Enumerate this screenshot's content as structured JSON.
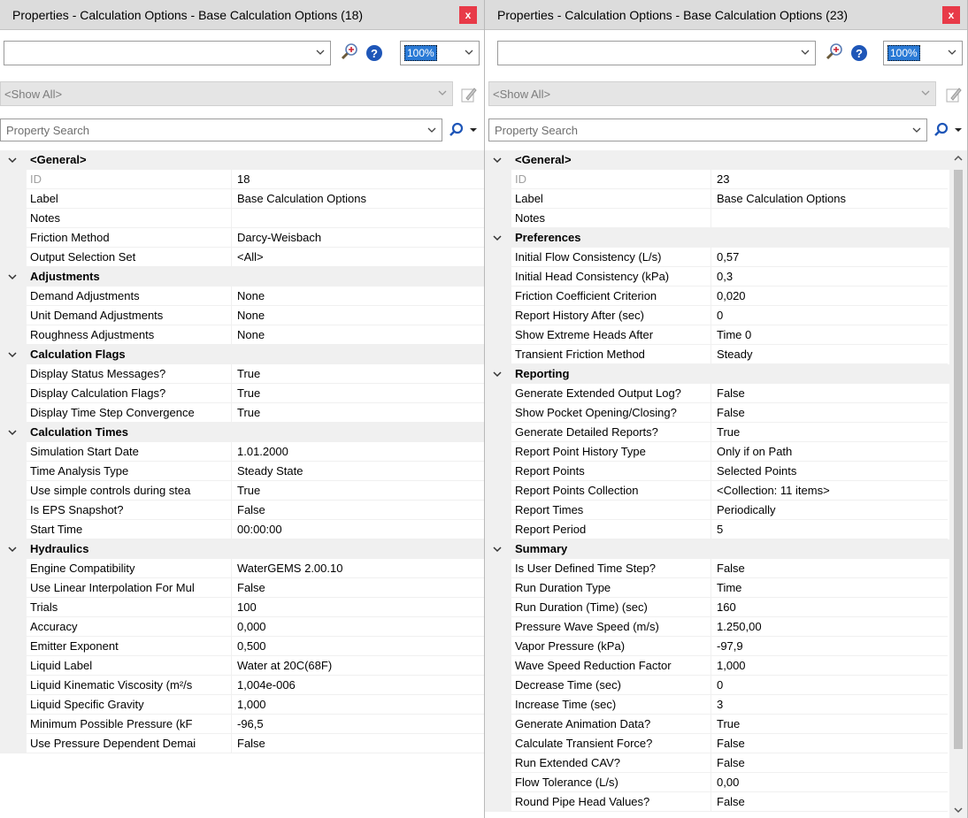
{
  "colors": {
    "close": "#e83a48",
    "selection": "#2a7ad6",
    "category_bg": "#f0f0f0"
  },
  "left": {
    "title": "Properties - Calculation Options - Base Calculation Options (18)",
    "close_label": "x",
    "zoom": "100%",
    "filter": "<Show All>",
    "search_placeholder": "Property Search",
    "categories": [
      {
        "label": "<General>",
        "rows": [
          {
            "name": "ID",
            "value": "18",
            "readonly": true
          },
          {
            "name": "Label",
            "value": "Base Calculation Options"
          },
          {
            "name": "Notes",
            "value": ""
          },
          {
            "name": "Friction Method",
            "value": "Darcy-Weisbach"
          },
          {
            "name": "Output Selection Set",
            "value": "<All>"
          }
        ]
      },
      {
        "label": "Adjustments",
        "rows": [
          {
            "name": "Demand Adjustments",
            "value": "None"
          },
          {
            "name": "Unit Demand Adjustments",
            "value": "None"
          },
          {
            "name": "Roughness Adjustments",
            "value": "None"
          }
        ]
      },
      {
        "label": "Calculation Flags",
        "rows": [
          {
            "name": "Display Status Messages?",
            "value": "True"
          },
          {
            "name": "Display Calculation Flags?",
            "value": "True"
          },
          {
            "name": "Display Time Step Convergence",
            "value": "True"
          }
        ]
      },
      {
        "label": "Calculation Times",
        "rows": [
          {
            "name": "Simulation Start Date",
            "value": "1.01.2000"
          },
          {
            "name": "Time Analysis Type",
            "value": "Steady State"
          },
          {
            "name": "Use simple controls during stea",
            "value": "True"
          },
          {
            "name": "Is EPS Snapshot?",
            "value": "False"
          },
          {
            "name": "Start Time",
            "value": "00:00:00"
          }
        ]
      },
      {
        "label": "Hydraulics",
        "rows": [
          {
            "name": "Engine Compatibility",
            "value": "WaterGEMS 2.00.10"
          },
          {
            "name": "Use Linear Interpolation For Mul",
            "value": "False"
          },
          {
            "name": "Trials",
            "value": "100"
          },
          {
            "name": "Accuracy",
            "value": "0,000"
          },
          {
            "name": "Emitter Exponent",
            "value": "0,500"
          },
          {
            "name": "Liquid Label",
            "value": "Water at 20C(68F)"
          },
          {
            "name": "Liquid Kinematic Viscosity (m²/s",
            "value": "1,004e-006"
          },
          {
            "name": "Liquid Specific Gravity",
            "value": "1,000"
          },
          {
            "name": "Minimum Possible Pressure (kF",
            "value": "-96,5"
          },
          {
            "name": "Use Pressure Dependent Demai",
            "value": "False"
          }
        ]
      }
    ]
  },
  "right": {
    "title": "Properties - Calculation Options - Base Calculation Options (23)",
    "close_label": "x",
    "zoom": "100%",
    "filter": "<Show All>",
    "search_placeholder": "Property Search",
    "categories": [
      {
        "label": "<General>",
        "rows": [
          {
            "name": "ID",
            "value": "23",
            "readonly": true
          },
          {
            "name": "Label",
            "value": "Base Calculation Options"
          },
          {
            "name": "Notes",
            "value": ""
          }
        ]
      },
      {
        "label": "Preferences",
        "rows": [
          {
            "name": "Initial Flow Consistency (L/s)",
            "value": "0,57"
          },
          {
            "name": "Initial Head Consistency (kPa)",
            "value": "0,3"
          },
          {
            "name": "Friction Coefficient Criterion",
            "value": "0,020"
          },
          {
            "name": "Report History After (sec)",
            "value": "0"
          },
          {
            "name": "Show Extreme Heads After",
            "value": "Time 0"
          },
          {
            "name": "Transient Friction Method",
            "value": "Steady"
          }
        ]
      },
      {
        "label": "Reporting",
        "rows": [
          {
            "name": "Generate Extended Output Log?",
            "value": "False"
          },
          {
            "name": "Show Pocket Opening/Closing?",
            "value": "False"
          },
          {
            "name": "Generate Detailed Reports?",
            "value": "True"
          },
          {
            "name": "Report Point History Type",
            "value": "Only if on Path"
          },
          {
            "name": "Report Points",
            "value": "Selected Points"
          },
          {
            "name": "Report Points Collection",
            "value": "<Collection: 11 items>"
          },
          {
            "name": "Report Times",
            "value": "Periodically"
          },
          {
            "name": "Report Period",
            "value": "5"
          }
        ]
      },
      {
        "label": "Summary",
        "rows": [
          {
            "name": "Is User Defined Time Step?",
            "value": "False"
          },
          {
            "name": "Run Duration Type",
            "value": "Time"
          },
          {
            "name": "Run Duration (Time) (sec)",
            "value": "160"
          },
          {
            "name": "Pressure Wave Speed (m/s)",
            "value": "1.250,00"
          },
          {
            "name": "Vapor Pressure (kPa)",
            "value": "-97,9"
          },
          {
            "name": "Wave Speed Reduction Factor",
            "value": "1,000"
          },
          {
            "name": "Decrease Time (sec)",
            "value": "0"
          },
          {
            "name": "Increase Time (sec)",
            "value": "3"
          },
          {
            "name": "Generate Animation Data?",
            "value": "True"
          },
          {
            "name": "Calculate Transient Force?",
            "value": "False"
          },
          {
            "name": "Run Extended CAV?",
            "value": "False"
          },
          {
            "name": "Flow Tolerance (L/s)",
            "value": "0,00"
          },
          {
            "name": "Round Pipe Head Values?",
            "value": "False"
          }
        ]
      }
    ]
  }
}
